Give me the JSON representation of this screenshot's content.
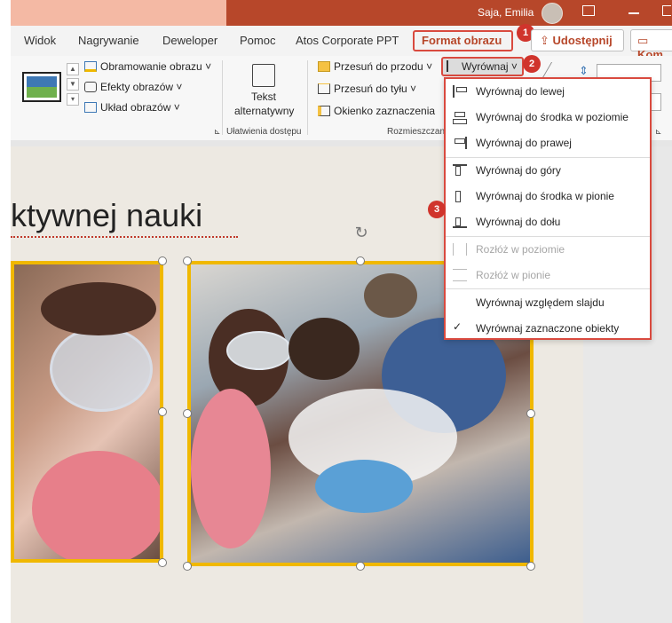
{
  "titlebar": {
    "user_name": "Saja, Emilia"
  },
  "tabs": [
    "Widok",
    "Nagrywanie",
    "Deweloper",
    "Pomoc",
    "Atos Corporate PPT"
  ],
  "active_tab": "Format obrazu",
  "share_label": "Udostępnij",
  "comment_label": "Kom",
  "ribbon": {
    "picture_border": "Obramowanie obrazu",
    "picture_effects": "Efekty obrazów",
    "picture_layout": "Układ obrazów",
    "alt_text_line1": "Tekst",
    "alt_text_line2": "alternatywny",
    "accessibility_group": "Ułatwienia dostępu",
    "bring_forward": "Przesuń do przodu",
    "send_backward": "Przesuń do tyłu",
    "selection_pane": "Okienko zaznaczenia",
    "arrange_group": "Rozmieszczan",
    "align_button": "Wyrównaj"
  },
  "align_menu": [
    {
      "label": "Wyrównaj do lewej",
      "icon": "align-left-icon",
      "disabled": false
    },
    {
      "label": "Wyrównaj do środka w poziomie",
      "icon": "align-center-icon",
      "disabled": false
    },
    {
      "label": "Wyrównaj do prawej",
      "icon": "align-right-icon",
      "disabled": false
    },
    {
      "label": "Wyrównaj do góry",
      "icon": "align-top-icon",
      "disabled": false
    },
    {
      "label": "Wyrównaj do środka w pionie",
      "icon": "align-middle-icon",
      "disabled": false
    },
    {
      "label": "Wyrównaj do dołu",
      "icon": "align-bottom-icon",
      "disabled": false
    },
    {
      "label": "Rozłóż w poziomie",
      "icon": "distribute-horizontal-icon",
      "disabled": true
    },
    {
      "label": "Rozłóż w pionie",
      "icon": "distribute-vertical-icon",
      "disabled": true
    },
    {
      "label": "Wyrównaj względem slajdu",
      "icon": "",
      "disabled": false,
      "checked": false
    },
    {
      "label": "Wyrównaj zaznaczone obiekty",
      "icon": "checkmark-icon",
      "disabled": false,
      "checked": true
    }
  ],
  "slide": {
    "title_fragment": "ktywnej nauki"
  },
  "badges": [
    "1",
    "2",
    "3"
  ],
  "colors": {
    "accent": "#b7472a",
    "highlight": "#d94a3f",
    "selection": "#f0b800"
  }
}
